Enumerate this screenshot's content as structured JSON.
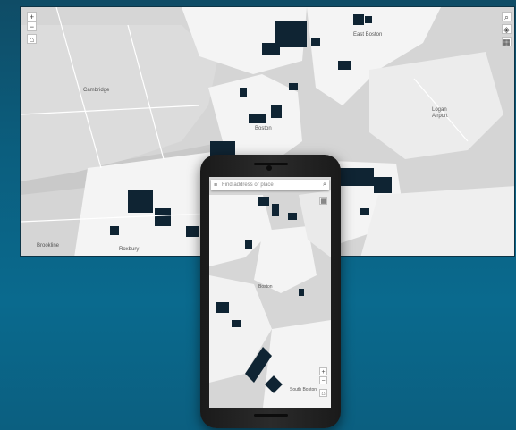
{
  "desktop_map": {
    "labels": {
      "cambridge": "Cambridge",
      "boston": "Boston",
      "east_boston": "East Boston",
      "airport_1": "Logan",
      "airport_2": "Airport",
      "roxbury": "Roxbury",
      "south": "Brookline"
    },
    "controls": {
      "zoom_in": "+",
      "zoom_out": "−",
      "home": "⌂",
      "search": "⌕",
      "layers": "◈",
      "basemap": "▦"
    }
  },
  "phone_map": {
    "search": {
      "menu_icon": "≡",
      "placeholder": "Find address or place",
      "search_icon": "⌕"
    },
    "labels": {
      "boston": "Boston",
      "south_boston": "South Boston"
    },
    "controls": {
      "basemap": "▦",
      "zoom_in": "+",
      "zoom_out": "−",
      "home": "⌂"
    }
  }
}
